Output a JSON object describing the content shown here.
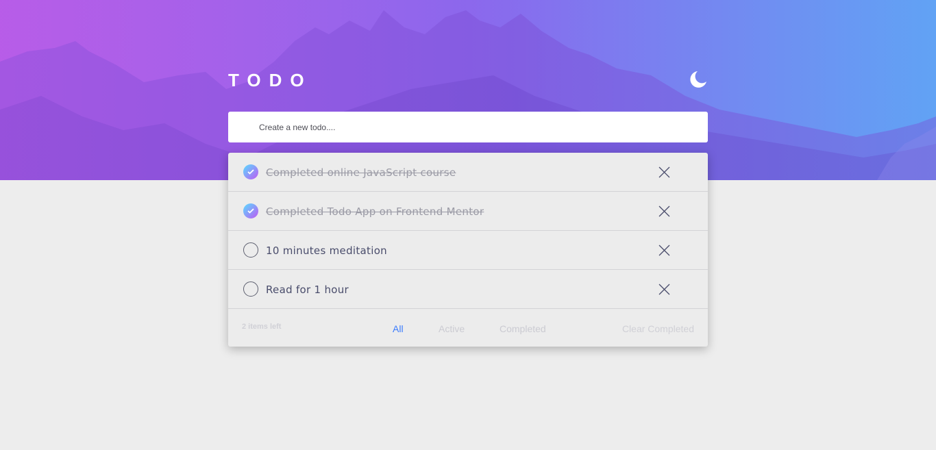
{
  "header": {
    "title": "TODO",
    "theme_icon": "moon-icon"
  },
  "new_todo": {
    "placeholder": "Create a new todo...."
  },
  "todos": [
    {
      "text": "Completed online JavaScript course",
      "completed": true
    },
    {
      "text": "Completed Todo App on Frontend Mentor",
      "completed": true
    },
    {
      "text": "10 minutes meditation",
      "completed": false
    },
    {
      "text": "Read for 1 hour",
      "completed": false
    }
  ],
  "footer": {
    "items_left": "2 items left",
    "filters": [
      "All",
      "Active",
      "Completed"
    ],
    "active_filter": "All",
    "clear_label": "Clear Completed"
  },
  "colors": {
    "accent": "#3a7bfd",
    "check_gradient_start": "#57ddff",
    "check_gradient_end": "#c058f3",
    "background": "#ededed"
  }
}
